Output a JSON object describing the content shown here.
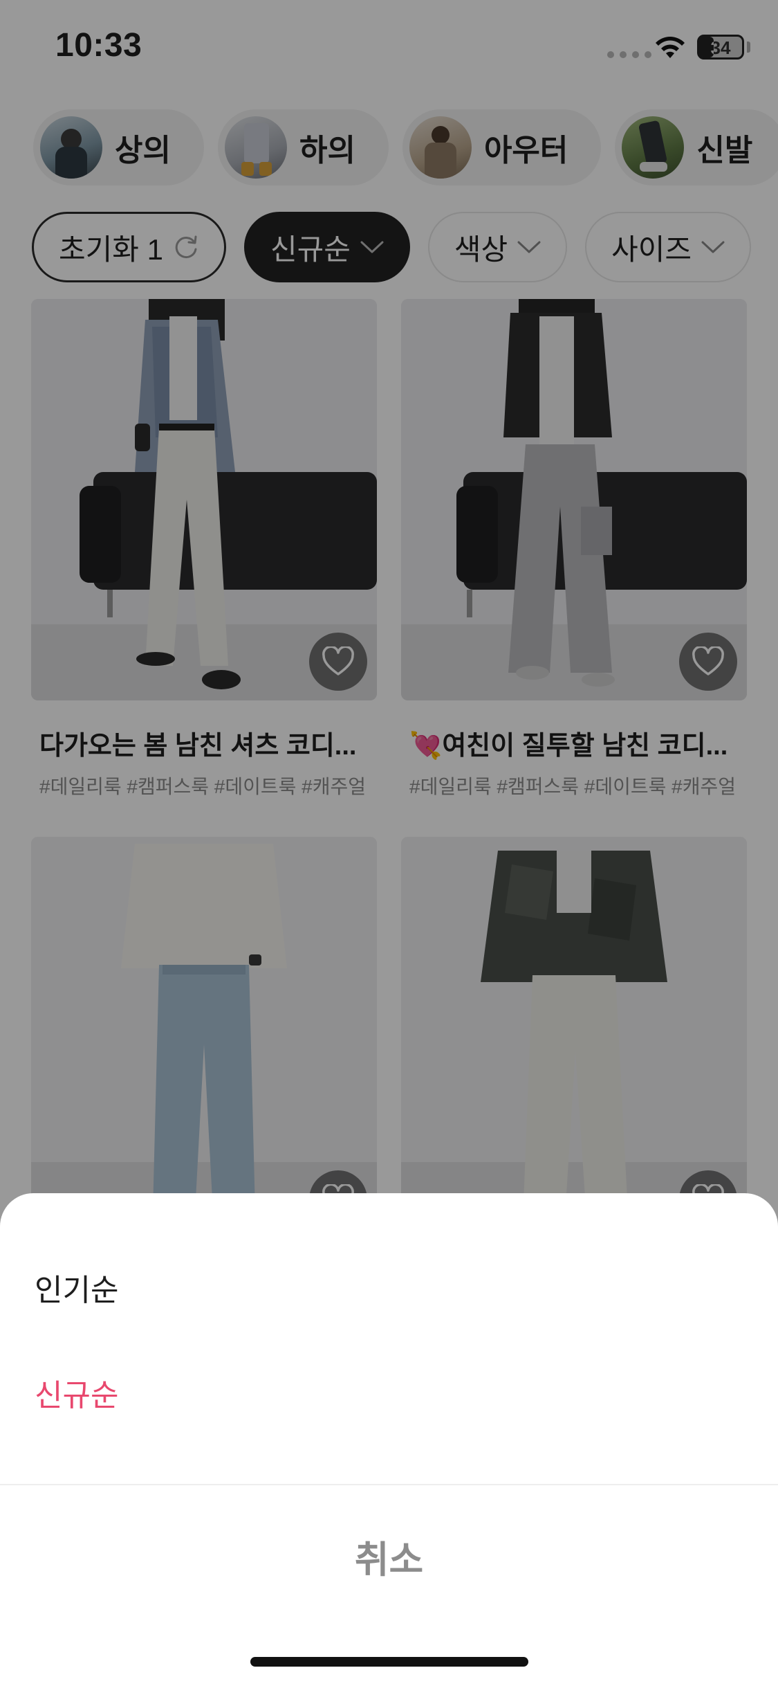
{
  "status_bar": {
    "time": "10:33",
    "battery": "34",
    "battery_level": 0.34
  },
  "categories": [
    {
      "label": "상의",
      "avatar": "top-avatar",
      "color": "#6a8a9a"
    },
    {
      "label": "하의",
      "avatar": "bottom-avatar",
      "color": "#8a8f9a"
    },
    {
      "label": "아우터",
      "avatar": "outer-avatar",
      "color": "#a08a70"
    },
    {
      "label": "신발",
      "avatar": "shoes-avatar",
      "color": "#5f7a45"
    }
  ],
  "filters": {
    "reset_label": "초기화 1",
    "sort_label": "신규순",
    "color_label": "색상",
    "size_label": "사이즈"
  },
  "products": [
    {
      "title": "다가오는 봄 남친 셔츠 코디...",
      "tags": "#데일리룩 #캠퍼스룩 #데이트룩 #캐주얼"
    },
    {
      "title": "💘여친이 질투할 남친 코디...",
      "tags": "#데일리룩 #캠퍼스룩 #데이트룩 #캐주얼"
    },
    {
      "title": "",
      "tags": ""
    },
    {
      "title": "",
      "tags": ""
    }
  ],
  "sheet": {
    "options": [
      "인기순",
      "신규순"
    ],
    "selected": "신규순",
    "cancel_label": "취소",
    "accent_color": "#e8486e"
  }
}
